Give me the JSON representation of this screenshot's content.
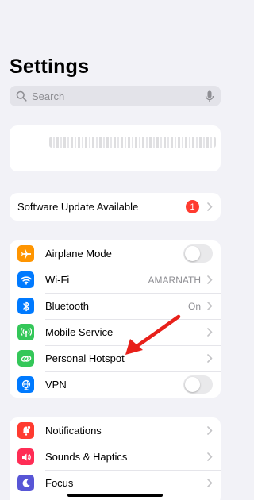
{
  "header": {
    "title": "Settings"
  },
  "search": {
    "placeholder": "Search"
  },
  "update": {
    "label": "Software Update Available",
    "badge": "1"
  },
  "connectivity": [
    {
      "label": "Airplane Mode",
      "value": "",
      "icon": "airplane-icon",
      "color": "#ff9500",
      "control": "toggle",
      "on": false
    },
    {
      "label": "Wi-Fi",
      "value": "AMARNATH",
      "icon": "wifi-icon",
      "color": "#007aff",
      "control": "chevron"
    },
    {
      "label": "Bluetooth",
      "value": "On",
      "icon": "bluetooth-icon",
      "color": "#007aff",
      "control": "chevron"
    },
    {
      "label": "Mobile Service",
      "value": "",
      "icon": "antenna-icon",
      "color": "#34c759",
      "control": "chevron"
    },
    {
      "label": "Personal Hotspot",
      "value": "",
      "icon": "link-icon",
      "color": "#34c759",
      "control": "chevron"
    },
    {
      "label": "VPN",
      "value": "",
      "icon": "globe-icon",
      "color": "#007aff",
      "control": "toggle",
      "on": false
    }
  ],
  "notifications_group": [
    {
      "label": "Notifications",
      "icon": "bell-icon",
      "color": "#ff3b30"
    },
    {
      "label": "Sounds & Haptics",
      "icon": "speaker-icon",
      "color": "#ff2d55"
    },
    {
      "label": "Focus",
      "icon": "moon-icon",
      "color": "#5856d6"
    }
  ],
  "annotation": {
    "color": "#e8201a"
  }
}
